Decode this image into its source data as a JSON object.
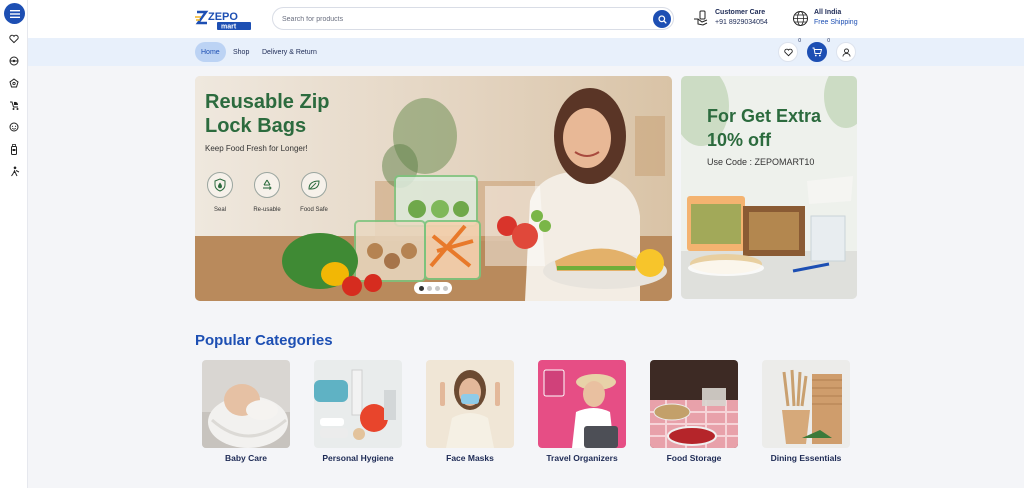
{
  "header": {
    "search_placeholder": "Search for products",
    "care_title": "Customer Care",
    "care_phone": "+91 8929034054",
    "ship_title": "All India",
    "ship_sub": "Free Shipping"
  },
  "nav": {
    "items": [
      {
        "label": "Home",
        "active": true
      },
      {
        "label": "Shop"
      },
      {
        "label": "Delivery & Return"
      }
    ],
    "wishlist_count": "0",
    "cart_count": "0"
  },
  "hero": {
    "title": "Reusable Zip Lock Bags",
    "subtitle": "Keep Food Fresh for Longer!",
    "features": [
      {
        "label": "Seal",
        "icon": "shield-drop-icon"
      },
      {
        "label": "Re-usable",
        "icon": "recycle-icon"
      },
      {
        "label": "Food Safe",
        "icon": "leaf-icon"
      }
    ],
    "slides": 4,
    "active_slide": 1
  },
  "offer": {
    "title": "For Get Extra 10% off",
    "code": "Use Code : ZEPOMART10"
  },
  "categories": {
    "heading": "Popular Categories",
    "items": [
      {
        "label": "Baby Care"
      },
      {
        "label": "Personal Hygiene"
      },
      {
        "label": "Face Masks"
      },
      {
        "label": "Travel Organizers"
      },
      {
        "label": "Food Storage"
      },
      {
        "label": "Dining Essentials"
      }
    ]
  },
  "colors": {
    "brand_blue": "#1d4fb3",
    "brand_green": "#2c6b3e",
    "nav_bg": "#e8f0fb"
  }
}
